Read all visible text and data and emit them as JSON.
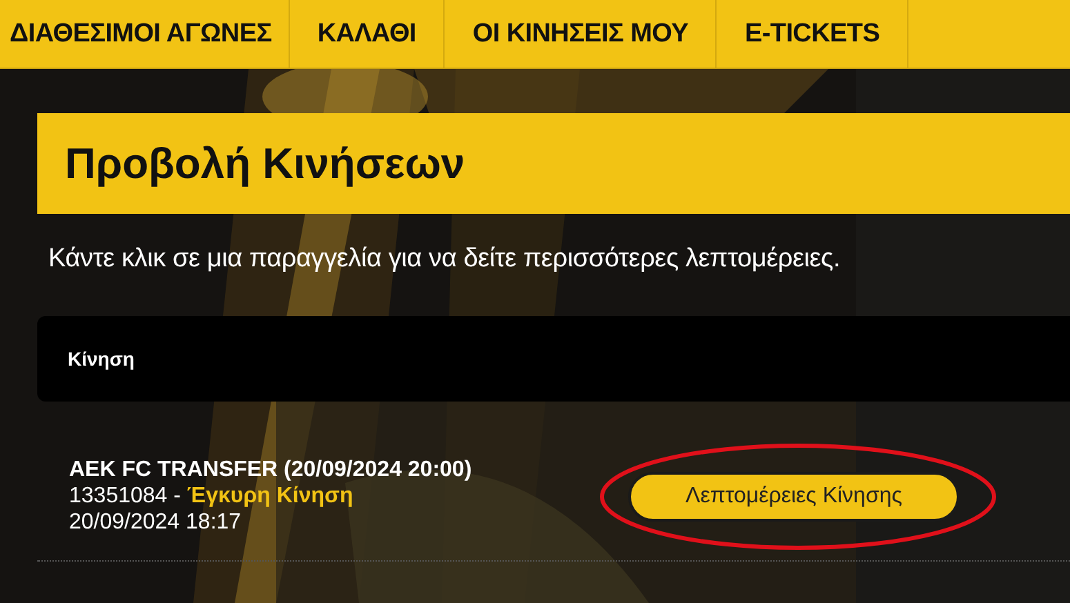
{
  "nav": {
    "items": [
      {
        "label": "ΔΙΑΘΕΣΙΜΟΙ ΑΓΩΝΕΣ"
      },
      {
        "label": "ΚΑΛΑΘΙ"
      },
      {
        "label": "ΟΙ ΚΙΝΗΣΕΙΣ ΜΟΥ"
      },
      {
        "label": "E-TICKETS"
      }
    ]
  },
  "page": {
    "title": "Προβολή Κινήσεων",
    "subtitle": "Κάντε κλικ σε μια παραγγελία για να δείτε περισσότερες λεπτομέρειες."
  },
  "table": {
    "header": "Κίνηση",
    "rows": [
      {
        "event": "AEK FC TRANSFER  (20/09/2024 20:00)",
        "order_number": "13351084 -",
        "status": "Έγκυρη Κίνηση",
        "date": "20/09/2024 18:17",
        "button": "Λεπτομέρειες Κίνησης",
        "highlighted": true
      }
    ]
  }
}
